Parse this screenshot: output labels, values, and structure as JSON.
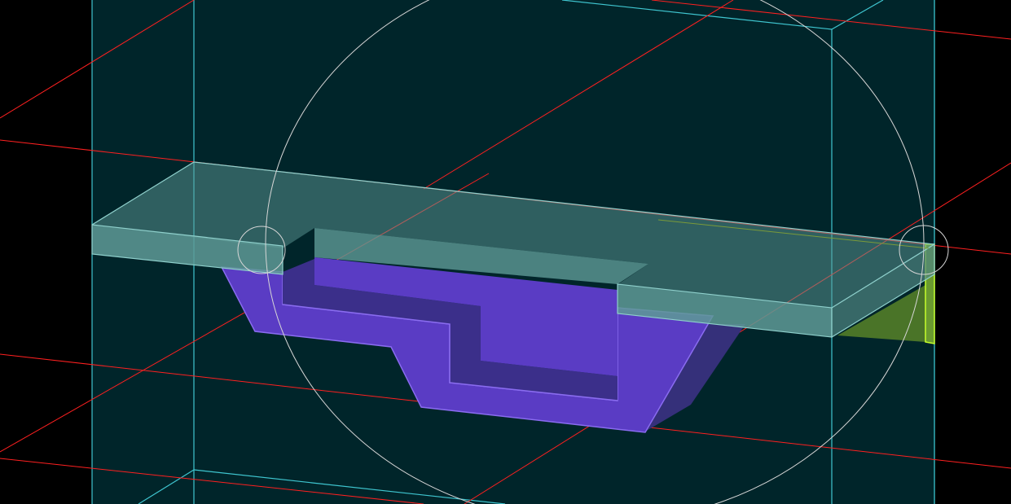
{
  "viewport": {
    "background_color": "#000000",
    "bounding_box_fill": "#00252a",
    "bounding_box_edge_color": "#3fc6d0",
    "grid_line_color": "#ff2020",
    "orbit_circle_color": "#d6d6d6",
    "slab_color": "#5e9a96",
    "slab_edge_color": "#8fd0cc",
    "footing_color": "#5a3cc4",
    "footing_edge_color": "#8a6cf0",
    "wall_color": "#4a7428",
    "wall_edge_color": "#c6ff2a"
  }
}
